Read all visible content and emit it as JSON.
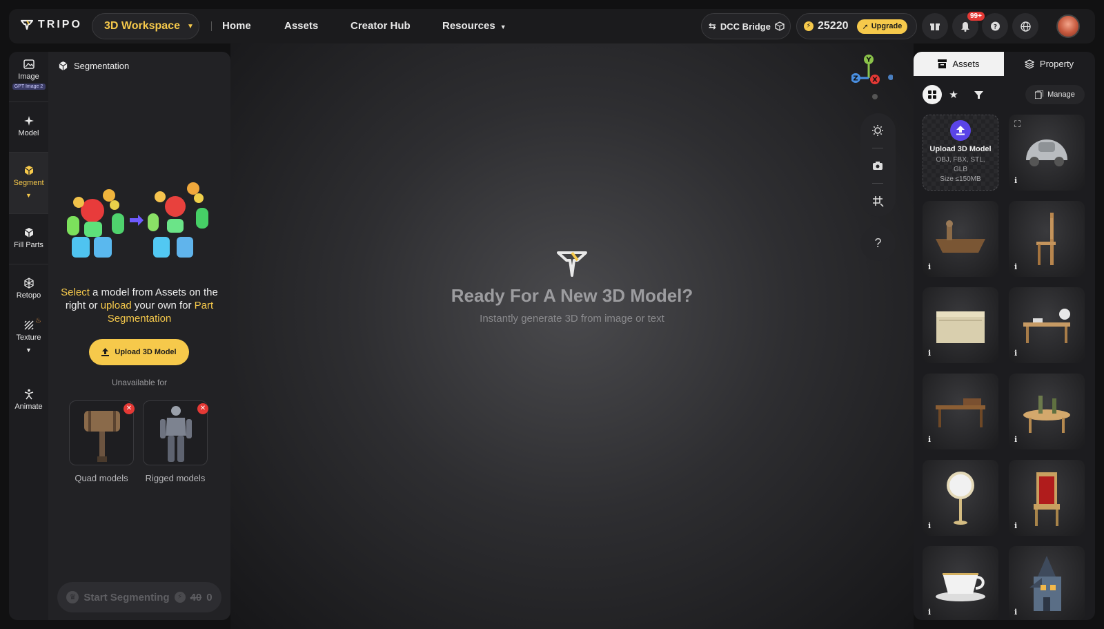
{
  "header": {
    "logo_text": "TRIPO",
    "workspace_label": "3D Workspace",
    "nav": [
      "Home",
      "Assets",
      "Creator Hub",
      "Resources"
    ],
    "dcc_bridge": "DCC Bridge",
    "credits": "25220",
    "upgrade_label": "Upgrade",
    "notification_badge": "99+"
  },
  "left_rail": {
    "items": [
      {
        "label": "Image",
        "badge": "GPT Image 2"
      },
      {
        "label": "Model"
      },
      {
        "label": "Segment"
      },
      {
        "label": "Fill Parts"
      },
      {
        "label": "Retopo"
      },
      {
        "label": "Texture"
      },
      {
        "label": "Animate"
      }
    ]
  },
  "segmentation": {
    "title": "Segmentation",
    "desc": {
      "select": "Select",
      "part1": " a model from Assets on the right or ",
      "upload": "upload",
      "part2": " your own for ",
      "part_seg": "Part Segmentation"
    },
    "upload_btn": "Upload 3D Model",
    "unavailable": "Unavailable for",
    "cards": [
      "Quad models",
      "Rigged models"
    ],
    "start_btn": "Start Segmenting",
    "cost_old": "40",
    "cost_new": "0"
  },
  "viewport": {
    "title": "Ready For A New 3D Model?",
    "subtitle": "Instantly generate 3D from image or text",
    "help": "?",
    "axes": {
      "y": "Y",
      "z": "Z",
      "x": "X"
    }
  },
  "assets_panel": {
    "tab_assets": "Assets",
    "tab_property": "Property",
    "manage": "Manage",
    "upload_card": {
      "title": "Upload 3D Model",
      "formats": "OBJ, FBX, STL, GLB",
      "size": "Size ≤150MB"
    },
    "items": [
      "beetle-car",
      "viking-boat",
      "wooden-chair",
      "wooden-crate",
      "desk-with-globe",
      "writing-desk",
      "round-table-bottles",
      "hand-mirror",
      "throne-chair",
      "teacup",
      "haunted-house"
    ]
  },
  "colors": {
    "accent": "#f6c94b",
    "upload_purple": "#5a44e8",
    "badge_red": "#e53935"
  }
}
